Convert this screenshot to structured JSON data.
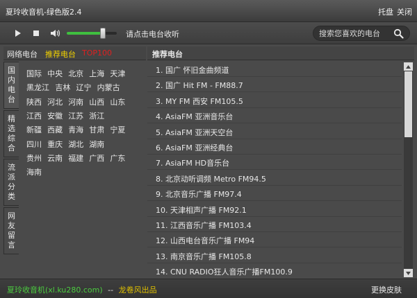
{
  "window": {
    "title": "夏玲收音机-绿色版2.4",
    "tray": "托盘",
    "close": "关闭"
  },
  "toolbar": {
    "hint": "请点击电台收听",
    "search_placeholder": "搜索您喜欢的电台",
    "volume_level": 0.72
  },
  "left_tabs": [
    "网络电台",
    "推荐电台",
    "TOP100"
  ],
  "side_tabs": [
    {
      "lines": [
        "国",
        "内",
        "电",
        "台"
      ]
    },
    {
      "lines": [
        "精",
        "选",
        "综",
        "合"
      ]
    },
    {
      "lines": [
        "流",
        "派",
        "分",
        "类"
      ]
    },
    {
      "lines": [
        "网",
        "友",
        "留",
        "言"
      ]
    }
  ],
  "regions": [
    [
      "国际",
      "中央",
      "北京",
      "上海",
      "天津"
    ],
    [
      "黑龙江",
      "吉林",
      "辽宁",
      "内蒙古"
    ],
    [
      "陕西",
      "河北",
      "河南",
      "山西",
      "山东"
    ],
    [
      "江西",
      "安徽",
      "江苏",
      "浙江"
    ],
    [
      "新疆",
      "西藏",
      "青海",
      "甘肃",
      "宁夏"
    ],
    [
      "四川",
      "重庆",
      "湖北",
      "湖南"
    ],
    [
      "贵州",
      "云南",
      "福建",
      "广西",
      "广东"
    ],
    [
      "海南"
    ]
  ],
  "right_header": "推荐电台",
  "stations": [
    "1. 国广 怀旧金曲频道",
    "2. 国广 Hit FM - FM88.7",
    "3. MY FM 西安 FM105.5",
    "4. AsiaFM 亚洲音乐台",
    "5. AsiaFM 亚洲天空台",
    "6. AsiaFM 亚洲经典台",
    "7. AsiaFM HD音乐台",
    "8. 北京动听调频 Metro FM94.5",
    "9. 北京音乐广播 FM97.4",
    "10. 天津相声广播 FM92.1",
    "11. 江西音乐广播 FM103.4",
    "12. 山西电台音乐广播 FM94",
    "13. 南京音乐广播 FM105.8",
    "14. CNU RADIO狂人音乐广播FM100.9"
  ],
  "footer": {
    "site": "夏玲收音机(xl.ku280.com)",
    "sep": "--",
    "author": "龙卷风出品",
    "skin": "更换皮肤"
  },
  "colors": {
    "accent_green": "#3fbf3f",
    "active_tab": "#f0d000",
    "top100": "#e02020",
    "footer_green": "#4ccc40",
    "footer_author": "#e0c000"
  }
}
